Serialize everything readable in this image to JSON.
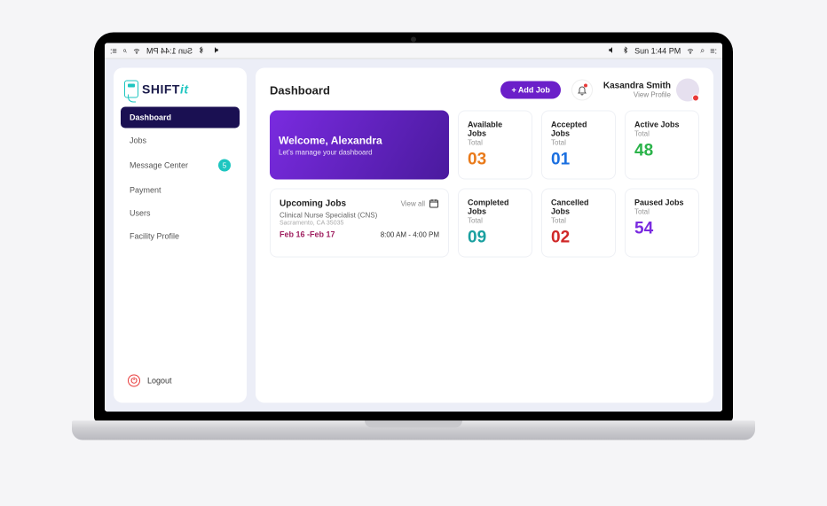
{
  "menubar": {
    "left": {
      "time": "Sun 1:44 PM"
    },
    "right": {
      "time": "Sun 1:44 PM"
    }
  },
  "logo": {
    "text_main": "SHIFT",
    "text_accent": "it"
  },
  "sidebar": {
    "items": [
      {
        "label": "Dashboard",
        "active": true
      },
      {
        "label": "Jobs",
        "active": false
      },
      {
        "label": "Message Center",
        "active": false,
        "badge": "5"
      },
      {
        "label": "Payment",
        "active": false
      },
      {
        "label": "Users",
        "active": false
      },
      {
        "label": "Facility Profile",
        "active": false
      }
    ],
    "logout": "Logout"
  },
  "header": {
    "title": "Dashboard",
    "add_job": "+ Add Job",
    "profile": {
      "name": "Kasandra Smith",
      "link": "View Profile"
    }
  },
  "welcome": {
    "title": "Welcome, Alexandra",
    "subtitle": "Let's manage your dashboard"
  },
  "stats": {
    "available": {
      "label": "Available Jobs",
      "sub": "Total",
      "value": "03",
      "color": "#e97a1a"
    },
    "accepted": {
      "label": "Accepted Jobs",
      "sub": "Total",
      "value": "01",
      "color": "#1a6fe0"
    },
    "active": {
      "label": "Active Jobs",
      "sub": "Total",
      "value": "48",
      "color": "#2bb34a"
    },
    "completed": {
      "label": "Completed Jobs",
      "sub": "Total",
      "value": "09",
      "color": "#1aa0a0"
    },
    "cancelled": {
      "label": "Cancelled Jobs",
      "sub": "Total",
      "value": "02",
      "color": "#d02828"
    },
    "paused": {
      "label": "Paused Jobs",
      "sub": "Total",
      "value": "54",
      "color": "#7a2be0"
    }
  },
  "upcoming": {
    "title": "Upcoming Jobs",
    "view_all": "View all",
    "role": "Clinical Nurse Specialist (CNS)",
    "location": "Sacramento, CA 35035",
    "dates": "Feb 16 -Feb 17",
    "time": "8:00 AM - 4:00 PM"
  }
}
